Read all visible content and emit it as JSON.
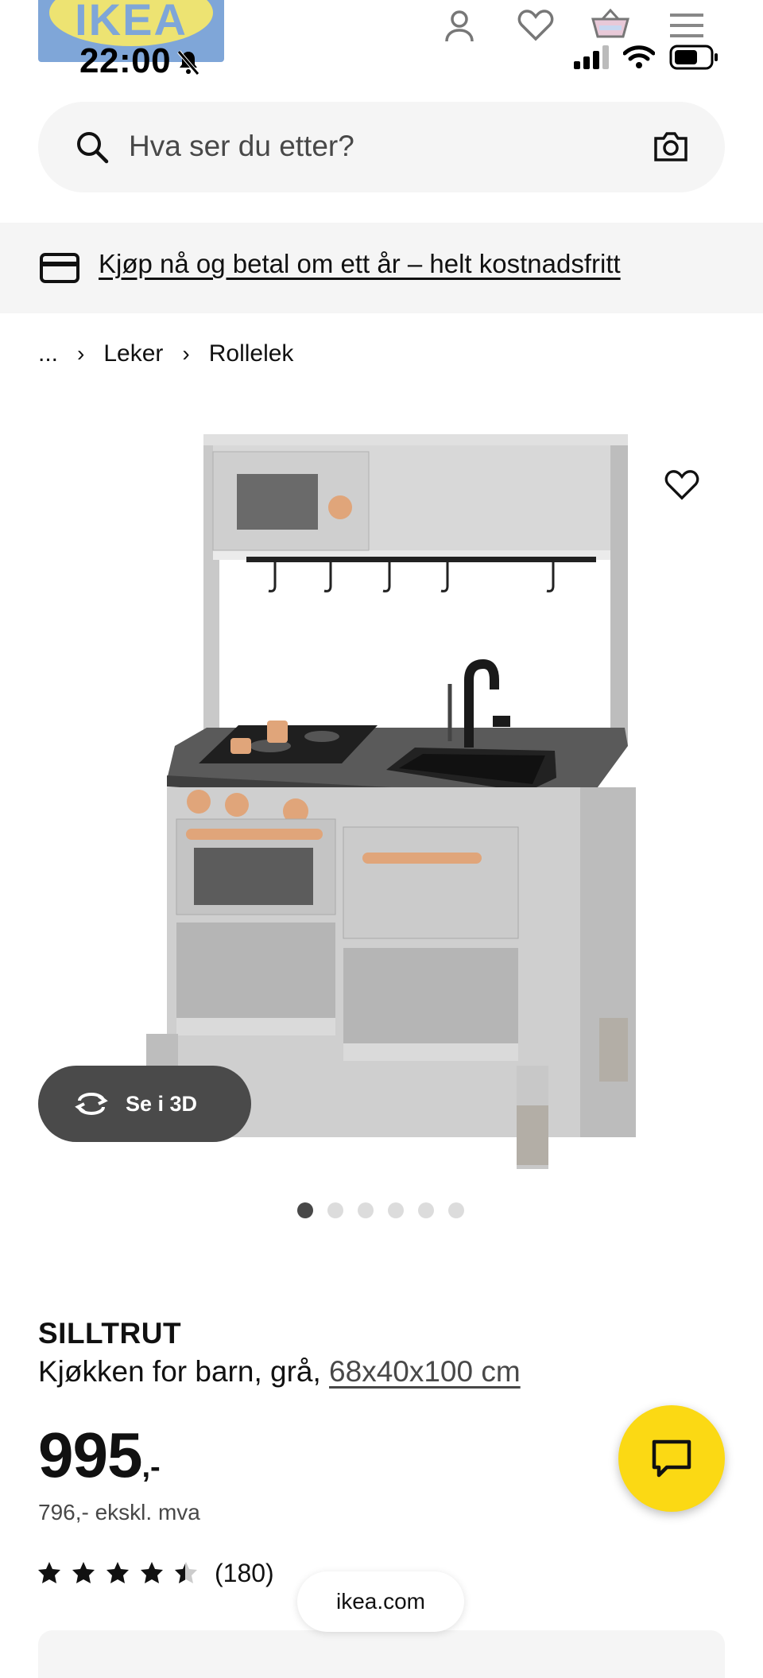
{
  "status_bar": {
    "time": "22:00"
  },
  "header": {
    "logo_text": "IKEA"
  },
  "search": {
    "placeholder": "Hva ser du etter?"
  },
  "promo": {
    "text": "Kjøp nå og betal om ett år – helt kostnadsfritt"
  },
  "breadcrumb": {
    "items": [
      "...",
      "Leker",
      "Rollelek"
    ]
  },
  "gallery": {
    "view_3d_label": "Se i 3D",
    "image_count": 6,
    "active_index": 0
  },
  "product": {
    "name": "SILLTRUT",
    "description": "Kjøkken for barn, grå, ",
    "dimensions": "68x40x100 cm",
    "price": "995",
    "price_suffix": ",-",
    "price_ex_vat": "796,- ekskl. mva",
    "rating": 4.5,
    "review_count": "(180)"
  },
  "browser": {
    "url": "ikea.com"
  },
  "colors": {
    "brand_yellow": "#fbd914",
    "brand_blue": "#0058a3",
    "surface": "#f5f5f5"
  }
}
